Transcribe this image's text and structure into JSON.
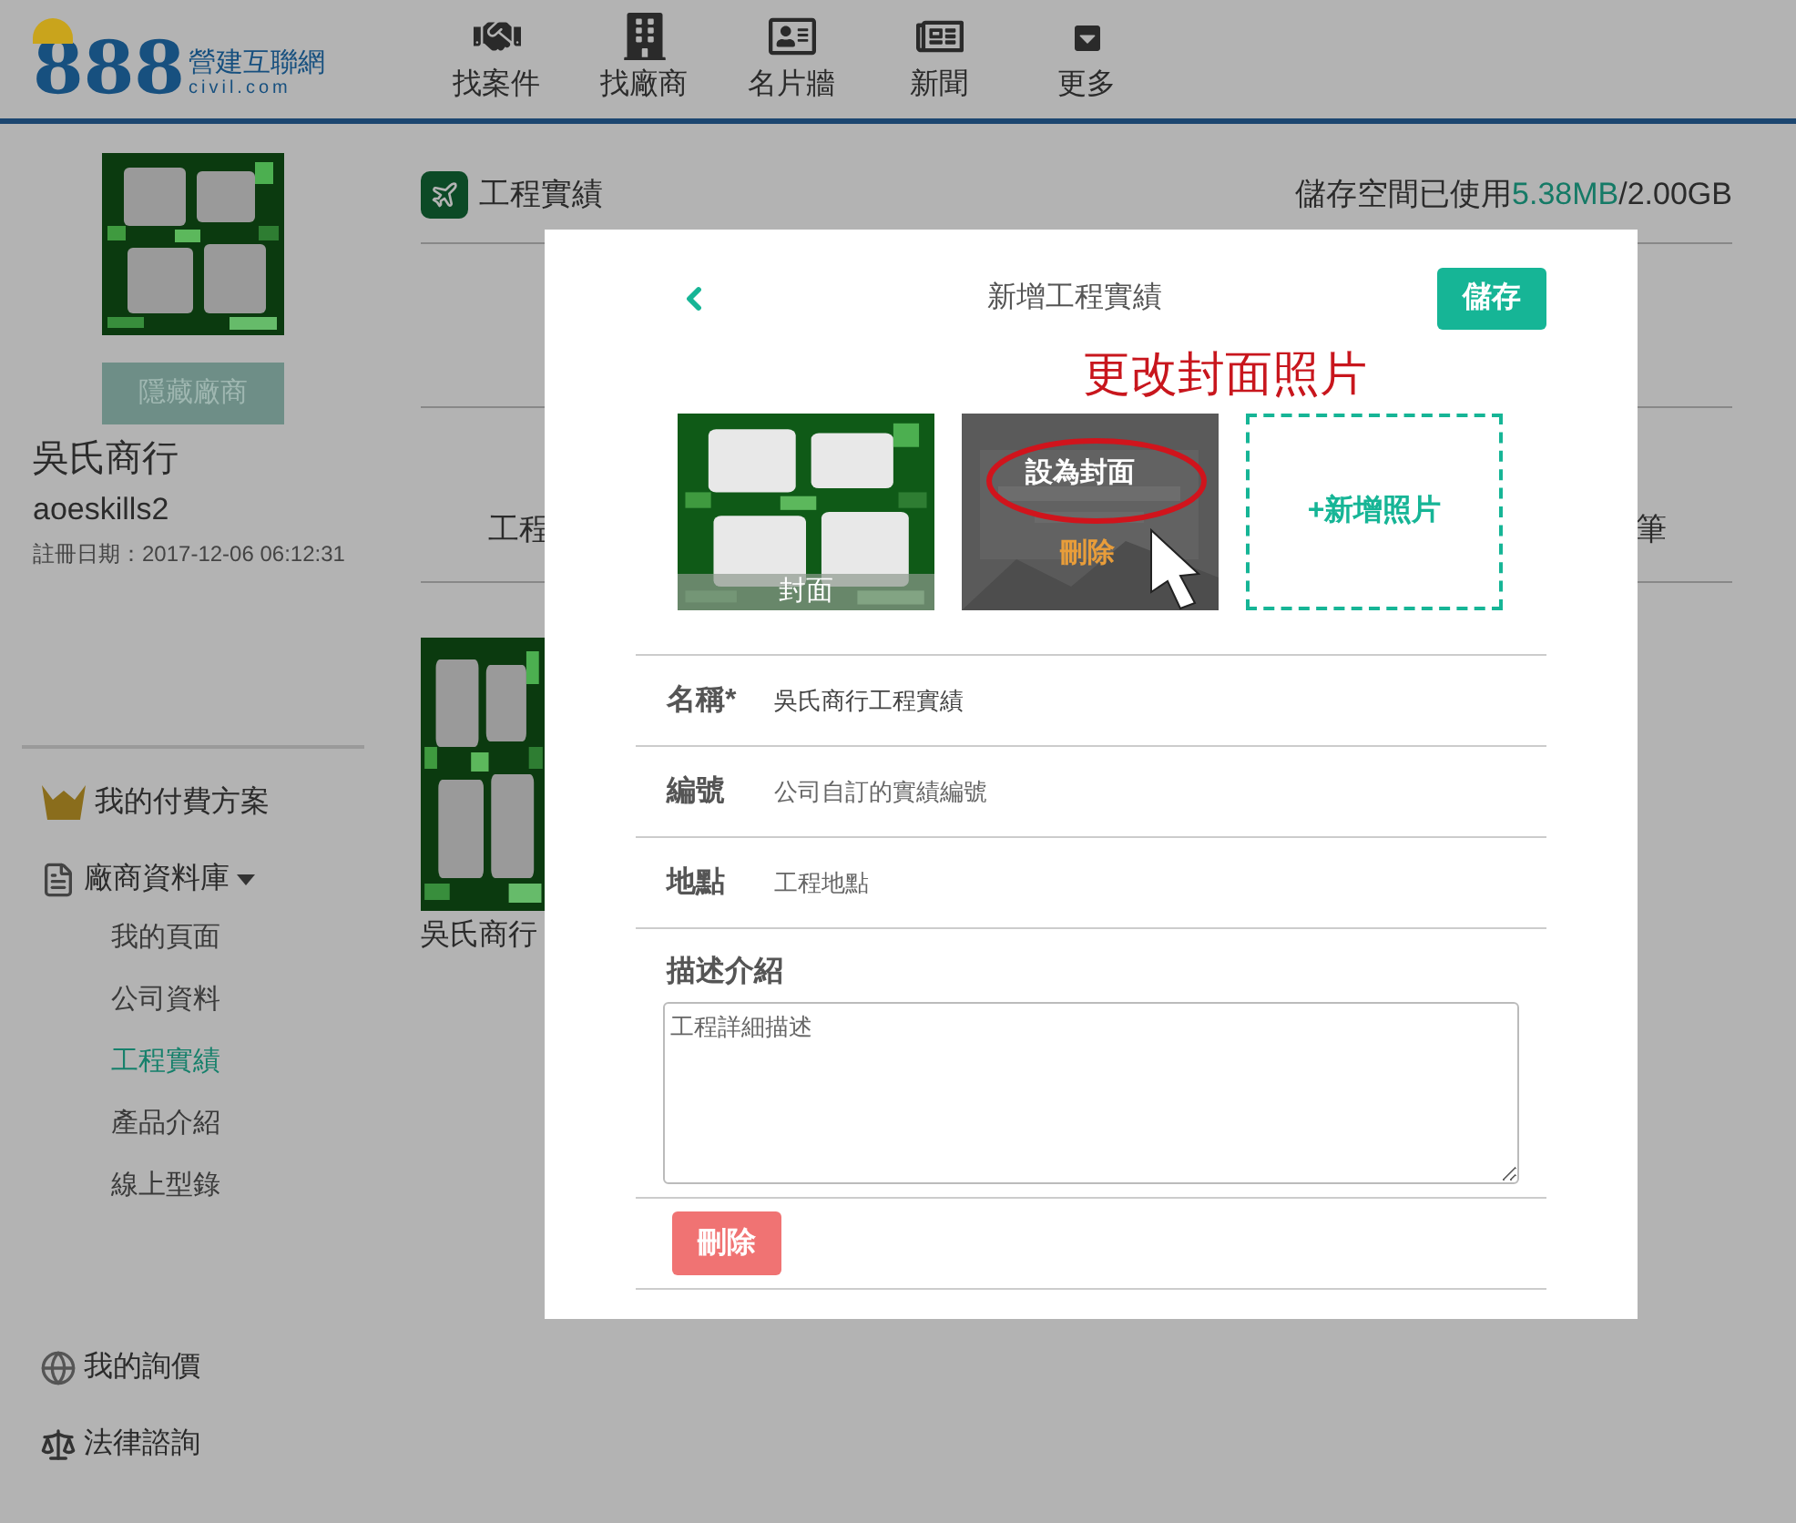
{
  "header": {
    "logo": {
      "number": "888",
      "name": "營建互聯網",
      "domain": "civil.com"
    },
    "nav": [
      {
        "label": "找案件"
      },
      {
        "label": "找廠商"
      },
      {
        "label": "名片牆"
      },
      {
        "label": "新聞"
      },
      {
        "label": "更多"
      }
    ]
  },
  "sidebar": {
    "company": {
      "name": "吳氏商行",
      "account": "aoeskills2",
      "registered": "註冊日期：2017-12-06 06:12:31"
    },
    "hide_button": "隱藏廠商",
    "menu": [
      {
        "label": "我的付費方案"
      },
      {
        "label": "廠商資料庫",
        "expanded": true,
        "children": [
          {
            "label": "我的頁面",
            "selected": false
          },
          {
            "label": "公司資料",
            "selected": false
          },
          {
            "label": "工程實績",
            "selected": true
          },
          {
            "label": "產品介紹",
            "selected": false
          },
          {
            "label": "線上型錄",
            "selected": false
          }
        ]
      },
      {
        "label": "我的詢價"
      },
      {
        "label": "法律諮詢"
      }
    ]
  },
  "main": {
    "title": "工程實績",
    "storage": {
      "prefix": "儲存空間已使用",
      "used": "5.38MB",
      "total": "/2.00GB"
    },
    "table": {
      "column_1": "工程",
      "column_2": "筆"
    },
    "card": {
      "caption": "吳氏商行"
    }
  },
  "modal": {
    "title": "新增工程實績",
    "save": "儲存",
    "annotation": "更改封面照片",
    "photos": [
      {
        "kind": "cover",
        "caption": "封面"
      },
      {
        "kind": "hover",
        "set_cover": "設為封面",
        "delete": "刪除"
      },
      {
        "kind": "add",
        "label": "+新增照片"
      }
    ],
    "fields": [
      {
        "label": "名稱*",
        "value": "吳氏商行工程實績"
      },
      {
        "label": "編號",
        "placeholder": "公司自訂的實績編號"
      },
      {
        "label": "地點",
        "placeholder": "工程地點"
      }
    ],
    "description": {
      "label": "描述介紹",
      "placeholder": "工程詳細描述"
    },
    "delete": "刪除"
  }
}
